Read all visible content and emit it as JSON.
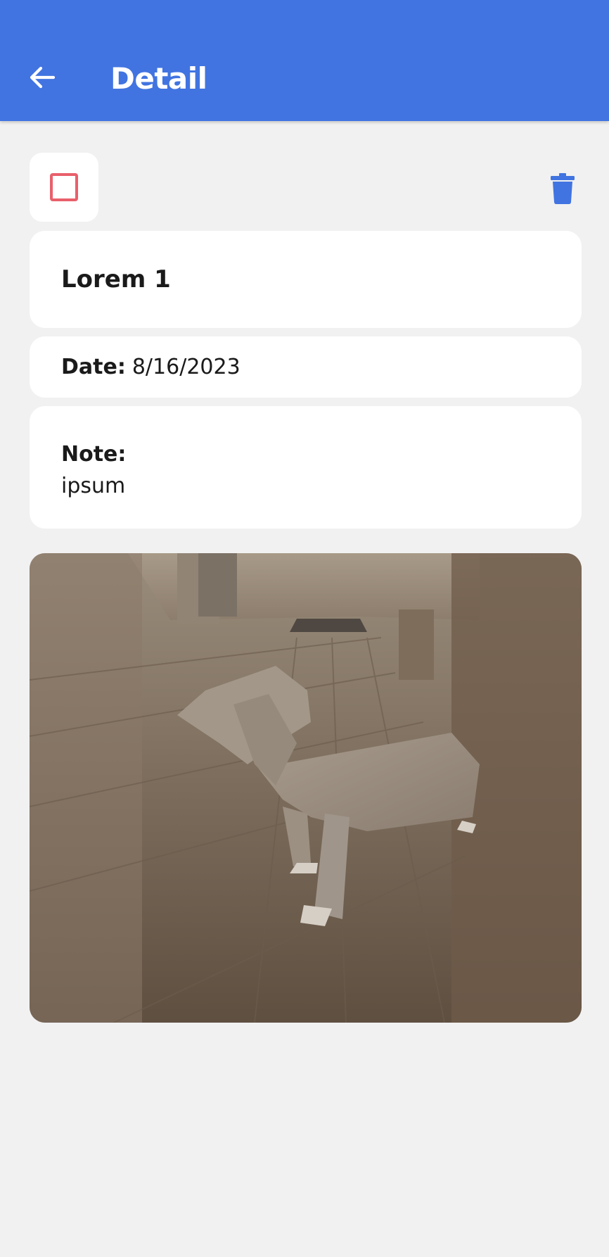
{
  "header": {
    "title": "Detail",
    "back_icon": "arrow-left-icon",
    "background_color": "#4174e1"
  },
  "actions": {
    "checkbox_checked": false,
    "checkbox_color": "#e8606b",
    "delete_icon": "trash-icon",
    "delete_color": "#4174e1"
  },
  "item": {
    "title": "Lorem 1",
    "date_label": "Date:",
    "date_value": "8/16/2023",
    "note_label": "Note:",
    "note_value": "ipsum"
  },
  "photo": {
    "subject": "low-poly dog in a kitchen with wooden floor"
  }
}
